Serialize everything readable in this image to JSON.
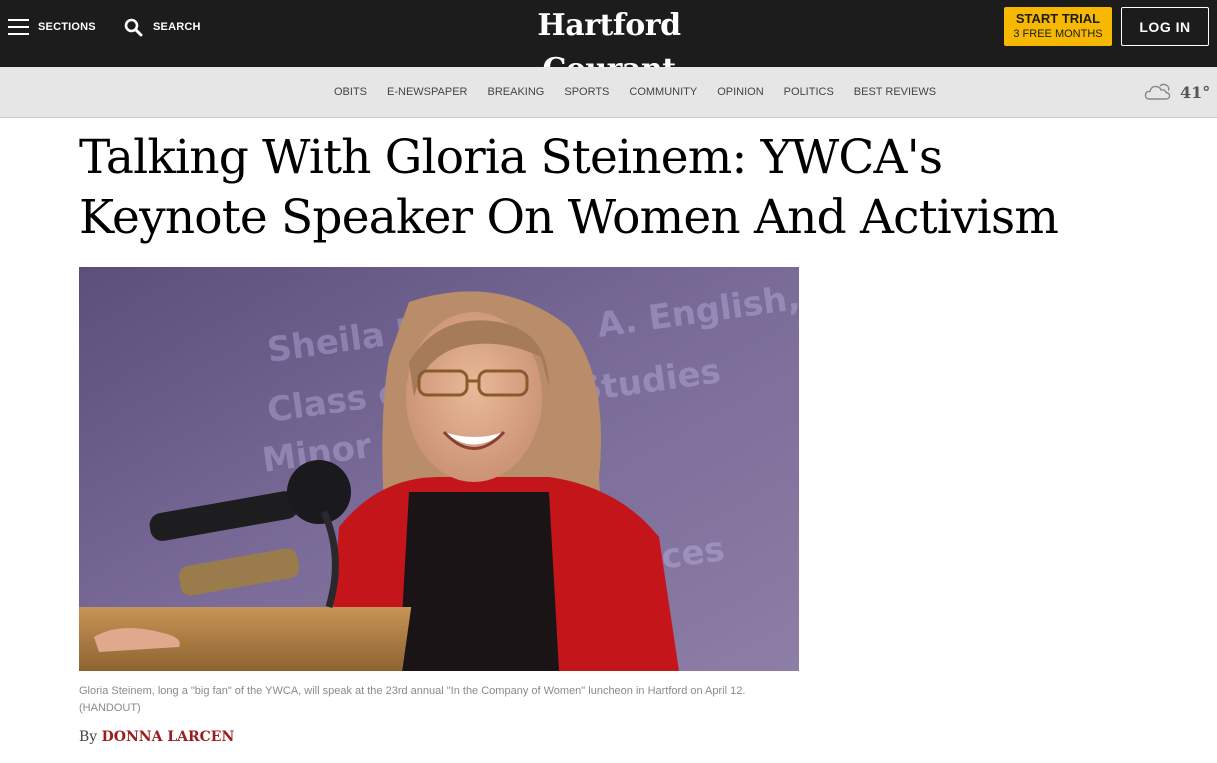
{
  "header": {
    "sections_label": "SECTIONS",
    "search_label": "SEARCH",
    "logo_text": "Hartford Courant",
    "trial_title": "START TRIAL",
    "trial_subtitle": "3 FREE MONTHS",
    "login_label": "LOG IN"
  },
  "nav": {
    "items": [
      "OBITS",
      "E-NEWSPAPER",
      "BREAKING",
      "SPORTS",
      "COMMUNITY",
      "OPINION",
      "POLITICS",
      "BEST REVIEWS"
    ]
  },
  "weather": {
    "icon": "cloud-icon",
    "temperature": "41°"
  },
  "article": {
    "headline": "Talking With Gloria Steinem: YWCA's Keynote Speaker On Women And Activism",
    "caption": "Gloria Steinem, long a \"big fan\" of the YWCA, will speak at the 23rd annual \"In the Company of Women\" luncheon in Hartford on April 12.  (HANDOUT)",
    "byline_prefix": "By",
    "author": "DONNA LARCEN"
  },
  "colors": {
    "topbar_bg": "#1c1c1c",
    "trial_bg": "#f6b800",
    "nav_bg": "#e6e6e6",
    "author_color": "#9b1c1c"
  }
}
